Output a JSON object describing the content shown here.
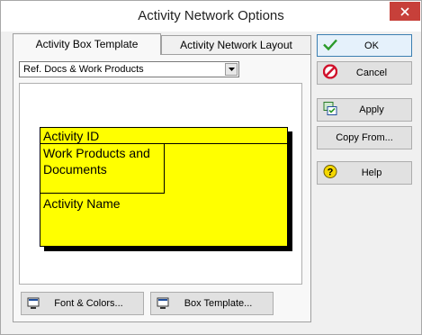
{
  "window": {
    "title": "Activity Network Options"
  },
  "tabs": [
    {
      "label": "Activity Box Template",
      "active": true
    },
    {
      "label": "Activity Network Layout",
      "active": false
    }
  ],
  "template_select": {
    "value": "Ref. Docs & Work Products"
  },
  "activity_box": {
    "id_field": "Activity ID",
    "work_products_field": "Work Products and Documents",
    "name_field": "Activity Name",
    "fill_color": "#ffff00"
  },
  "panel_buttons": {
    "font_colors": "Font & Colors...",
    "box_template": "Box Template..."
  },
  "side_buttons": {
    "ok": "OK",
    "cancel": "Cancel",
    "apply": "Apply",
    "copy_from": "Copy From...",
    "help": "Help"
  },
  "icons": {
    "close": "close-icon",
    "ok": "checkmark-icon",
    "cancel": "no-entry-icon",
    "apply": "apply-icon",
    "help": "question-icon",
    "font_colors": "monitor-icon",
    "box_template": "monitor-icon"
  },
  "colors": {
    "close_button": "#c7403a",
    "ok_focus_border": "#3c7fb1"
  }
}
